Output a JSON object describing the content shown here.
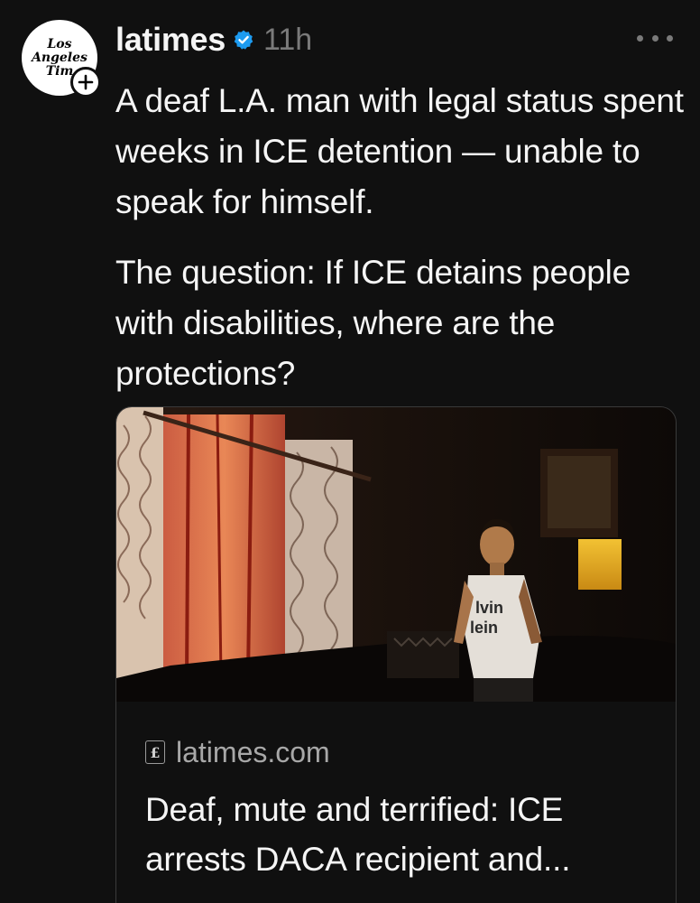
{
  "author": {
    "avatar_text": [
      "Los",
      "Angeles",
      "Tim"
    ],
    "username": "latimes",
    "verified": true,
    "timestamp": "11h",
    "icons": [
      "verified-badge-icon",
      "follow-plus-icon",
      "more-options-icon"
    ]
  },
  "post": {
    "paragraphs": [
      "A deaf L.A. man with legal status spent weeks in ICE detention — unable to speak for himself.",
      "The question: If ICE detains people with disabilities, where are the protections?"
    ]
  },
  "link_card": {
    "site_icon_glyph": "£",
    "domain": "latimes.com",
    "headline": "Deaf, mute and terrified: ICE arrests DACA recipient and...",
    "shirt_text": [
      "lvin",
      "lein"
    ]
  },
  "colors": {
    "background": "#101010",
    "text": "#f5f5f5",
    "muted": "#7a7a7a",
    "verified": "#1d9bf0"
  }
}
